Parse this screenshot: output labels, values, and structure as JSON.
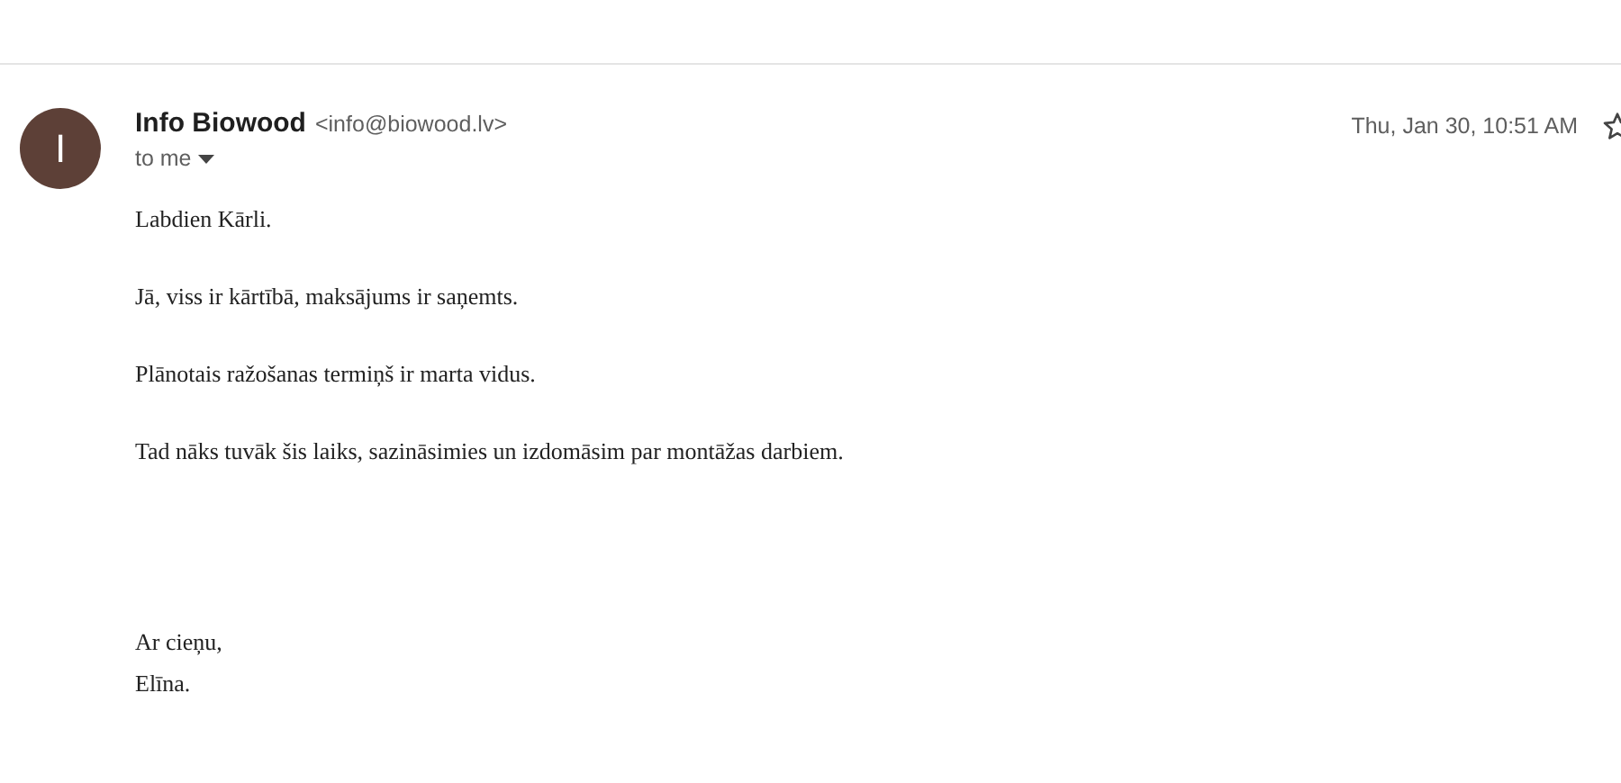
{
  "sender": {
    "avatar_letter": "I",
    "name": "Info Biowood",
    "email": "<info@biowood.lv>",
    "recipient": "to me"
  },
  "date": "Thu, Jan 30, 10:51 AM",
  "starred": false,
  "body": {
    "paragraphs": [
      "Labdien Kārli.",
      "Jā, viss ir kārtībā, maksājums ir saņemts.",
      "Plānotais ražošanas termiņš ir marta vidus.",
      "Tad nāks tuvāk šis laiks, sazināsimies un izdomāsim par montāžas darbiem."
    ],
    "signature": [
      "Ar cieņu,",
      "Elīna."
    ]
  }
}
